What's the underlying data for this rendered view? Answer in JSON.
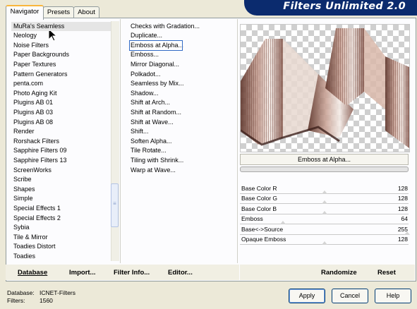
{
  "tabs": [
    {
      "label": "Navigator",
      "active": true
    },
    {
      "label": "Presets",
      "active": false
    },
    {
      "label": "About",
      "active": false
    }
  ],
  "banner_title": "Filters Unlimited 2.0",
  "categories": [
    "MuRa's Seamless",
    "Neology",
    "Noise Filters",
    "Paper Backgrounds",
    "Paper Textures",
    "Pattern Generators",
    "penta.com",
    "Photo Aging Kit",
    "Plugins AB 01",
    "Plugins AB 03",
    "Plugins AB 08",
    "Render",
    "Rorshack Filters",
    "Sapphire Filters 09",
    "Sapphire Filters 13",
    "ScreenWorks",
    "Scribe",
    "Shapes",
    "Simple",
    "Special Effects 1",
    "Special Effects 2",
    "Sybia",
    "Tile & Mirror",
    "Toadies Distort",
    "Toadies"
  ],
  "selected_category": "MuRa's Seamless",
  "filters": [
    "Checks with Gradation...",
    "Duplicate...",
    "Emboss at Alpha...",
    "Emboss...",
    "Mirror Diagonal...",
    "Polkadot...",
    "Seamless by Mix...",
    "Shadow...",
    "Shift at Arch...",
    "Shift at Random...",
    "Shift at Wave...",
    "Shift...",
    "Soften Alpha...",
    "Tile Rotate...",
    "Tiling with Shrink...",
    "Warp at Wave..."
  ],
  "selected_filter": "Emboss at Alpha...",
  "filter_name_button": "Emboss at Alpha...",
  "sliders": [
    {
      "label": "Base Color R",
      "value": 128,
      "fraction": 0.502
    },
    {
      "label": "Base Color G",
      "value": 128,
      "fraction": 0.502
    },
    {
      "label": "Base Color B",
      "value": 128,
      "fraction": 0.502
    },
    {
      "label": "Emboss",
      "value": 64,
      "fraction": 0.251
    },
    {
      "label": "Base<->Source",
      "value": 255,
      "fraction": 1.0
    },
    {
      "label": "Opaque Emboss",
      "value": 128,
      "fraction": 0.502
    }
  ],
  "bottom_actions": {
    "database": "Database",
    "import": "Import...",
    "filter_info": "Filter Info...",
    "editor": "Editor...",
    "randomize": "Randomize",
    "reset": "Reset"
  },
  "status": {
    "database_label": "Database:",
    "database_value": "ICNET-Filters",
    "filters_label": "Filters:",
    "filters_value": "1560"
  },
  "dialog_buttons": {
    "apply": "Apply",
    "cancel": "Cancel",
    "help": "Help"
  },
  "colors": {
    "banner": "#0b2b6e",
    "tab_highlight": "#f9b63c",
    "selection_outline": "#316ac5"
  },
  "icons": {
    "cursor": "arrow-cursor-icon"
  }
}
